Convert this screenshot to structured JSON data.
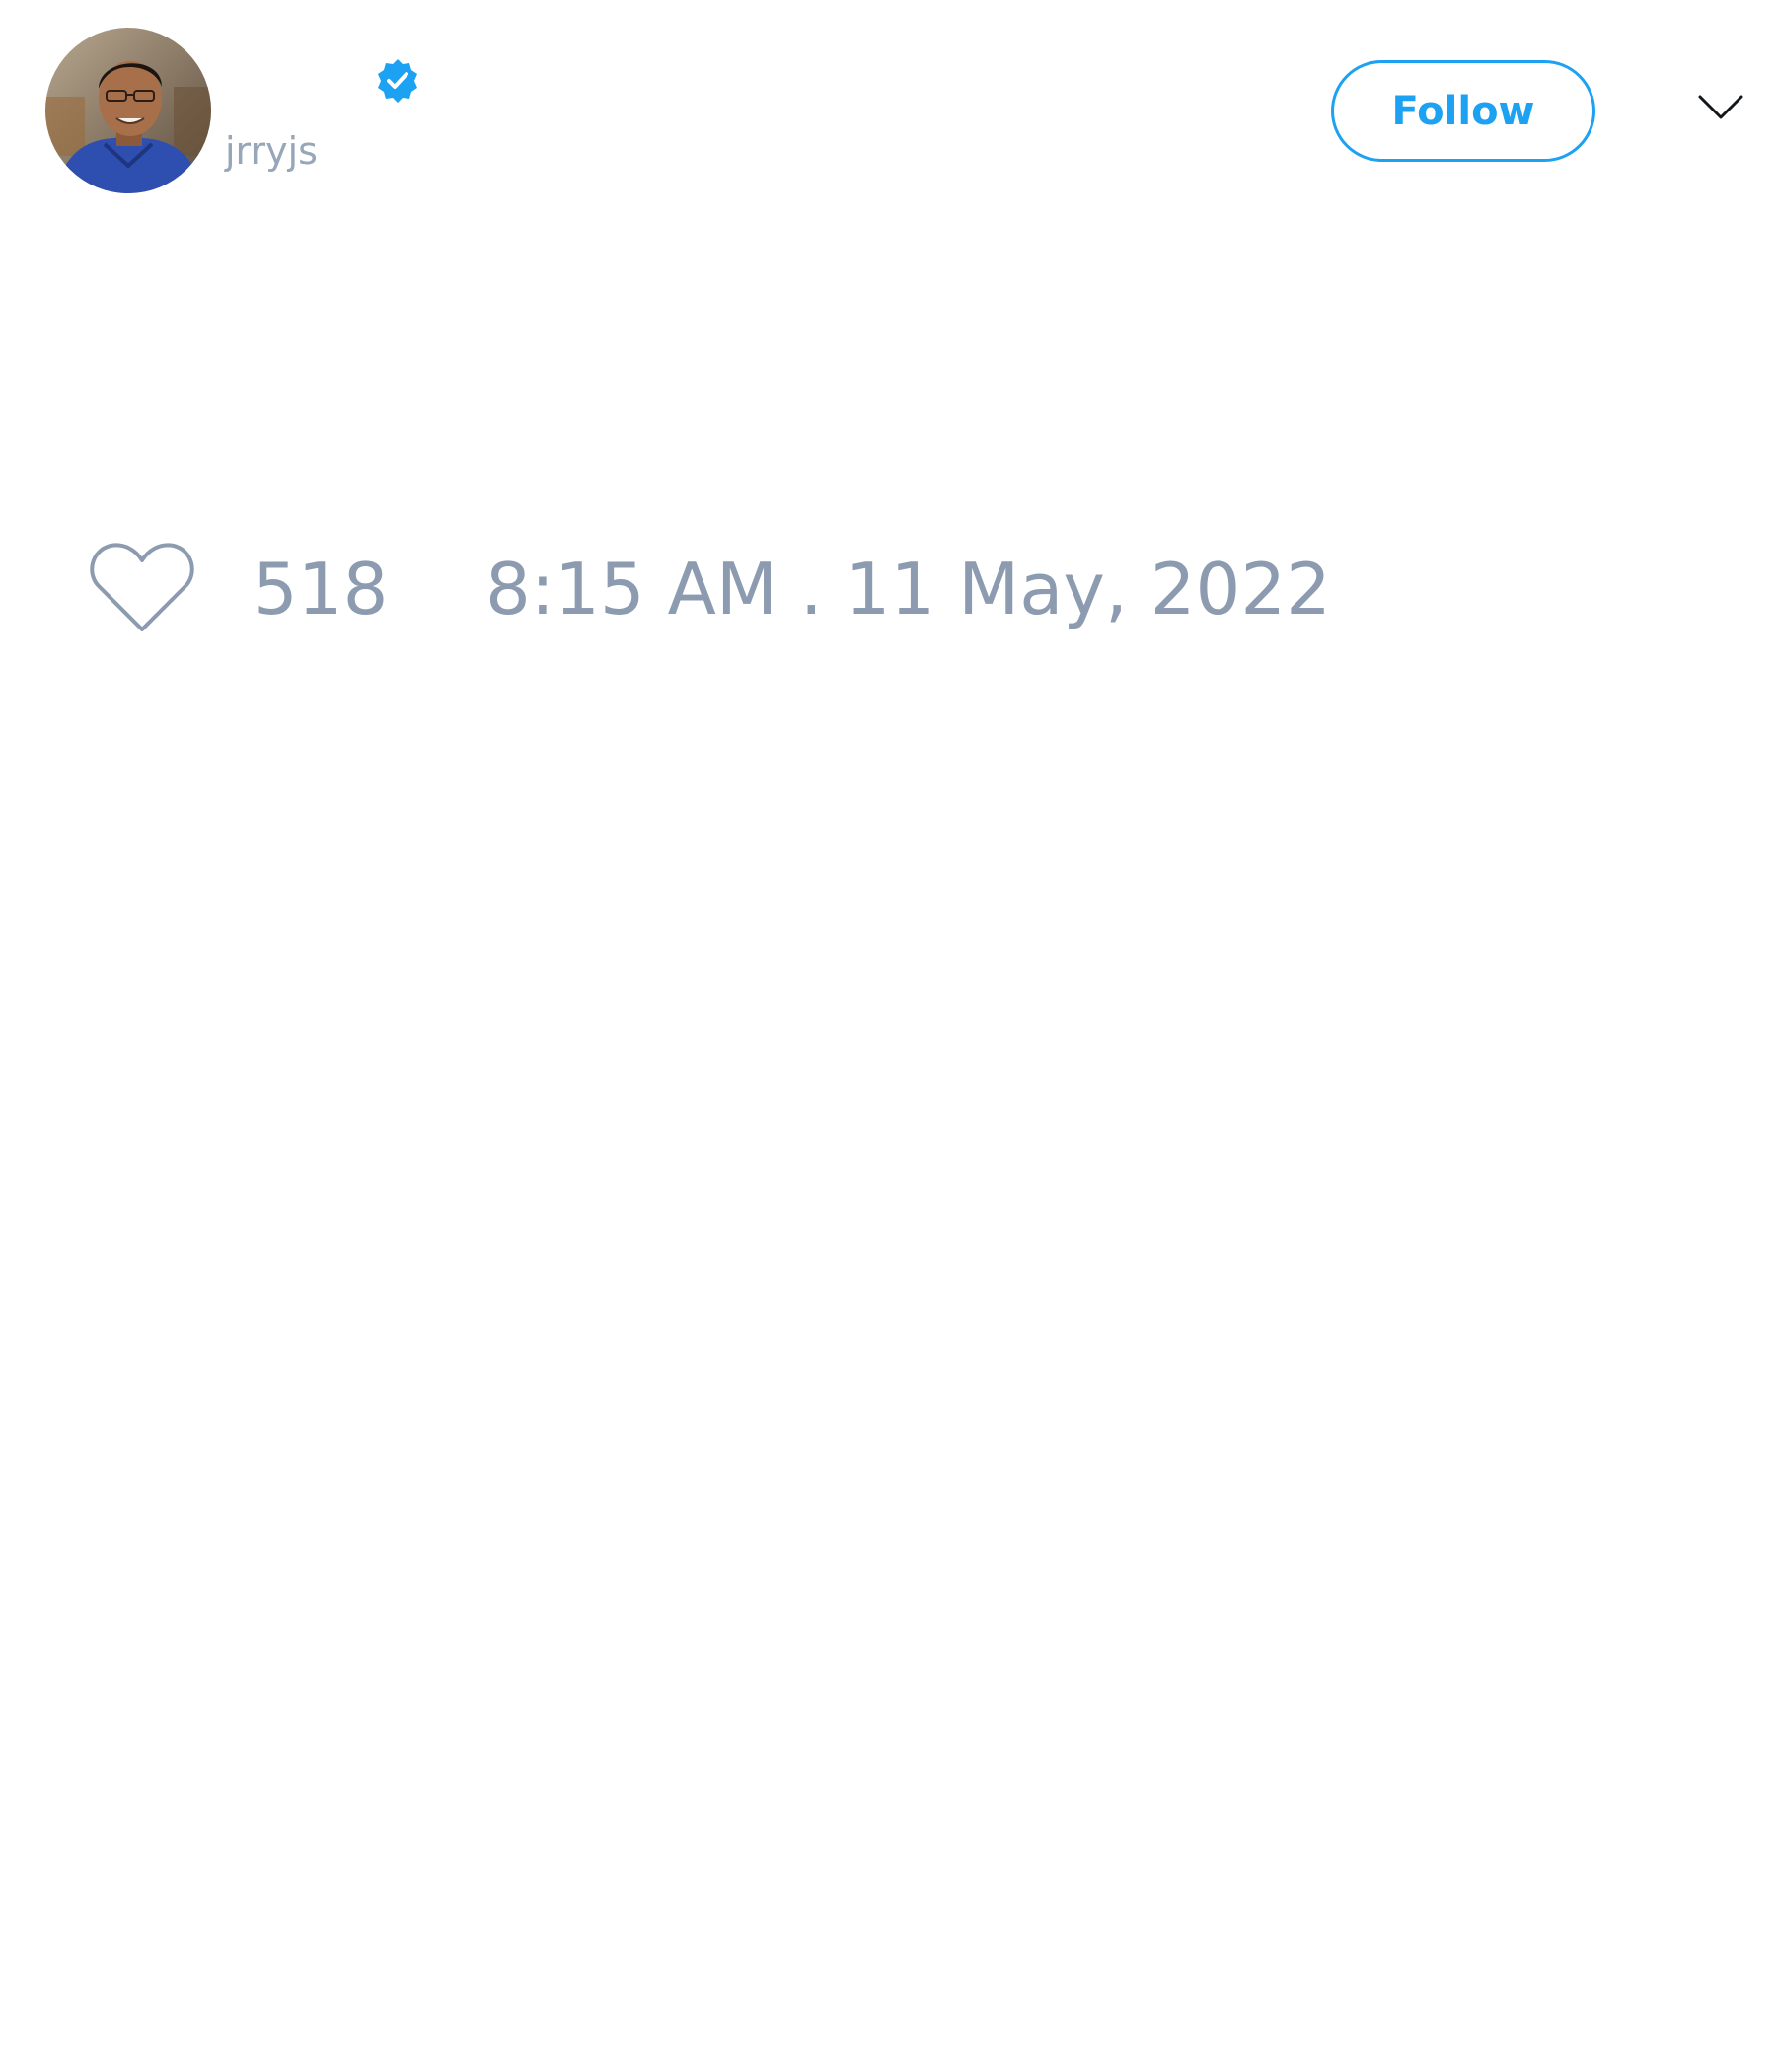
{
  "author": {
    "display_name": "",
    "handle": "jrryjs",
    "verified": true
  },
  "actions": {
    "follow_label": "Follow",
    "menu_icon": "chevron-down-icon"
  },
  "stats": {
    "like_icon": "heart-icon",
    "like_count": "518",
    "timestamp": "8:15 AM . 11 May, 2022"
  },
  "colors": {
    "accent": "#1da1f2",
    "muted_text": "#8c9bb0",
    "handle_text": "#97a6b8",
    "background": "#ffffff"
  }
}
